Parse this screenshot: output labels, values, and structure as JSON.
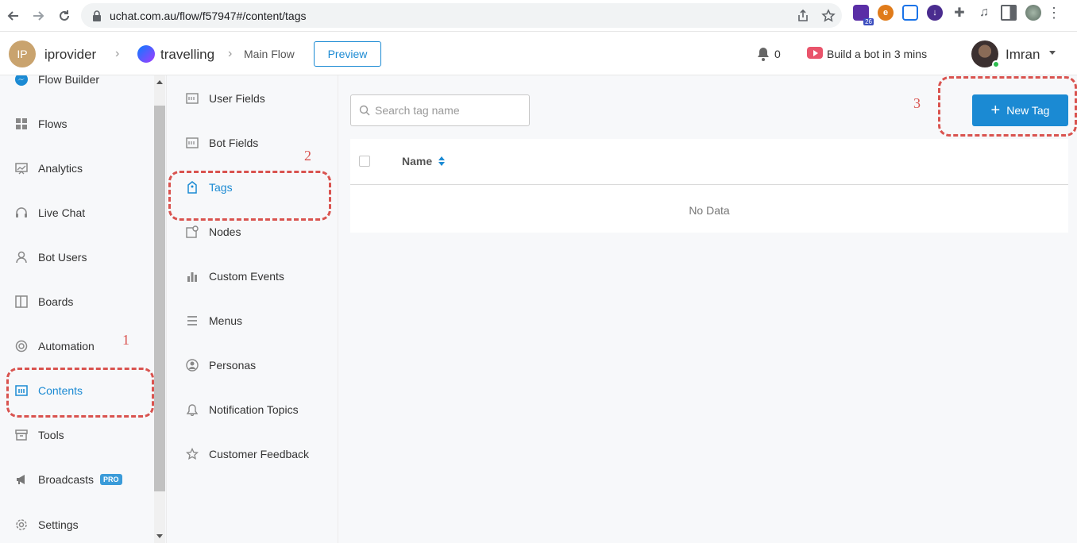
{
  "browser": {
    "url": "uchat.com.au/flow/f57947#/content/tags",
    "ext_badge": "26"
  },
  "header": {
    "workspace_initials": "IP",
    "workspace_name": "iprovider",
    "bot_name": "travelling",
    "flow_name": "Main Flow",
    "preview_label": "Preview",
    "notification_count": "0",
    "build_link": "Build a bot in 3 mins",
    "user_name": "Imran"
  },
  "sidebar": {
    "items": [
      {
        "label": "Flow Builder",
        "icon": "messenger-icon"
      },
      {
        "label": "Flows",
        "icon": "grid-icon"
      },
      {
        "label": "Analytics",
        "icon": "chart-icon"
      },
      {
        "label": "Live Chat",
        "icon": "headset-icon"
      },
      {
        "label": "Bot Users",
        "icon": "user-icon"
      },
      {
        "label": "Boards",
        "icon": "board-icon"
      },
      {
        "label": "Automation",
        "icon": "lifebuoy-icon"
      },
      {
        "label": "Contents",
        "icon": "content-icon",
        "active": true
      },
      {
        "label": "Tools",
        "icon": "box-icon"
      },
      {
        "label": "Broadcasts",
        "icon": "megaphone-icon",
        "badge": "PRO"
      },
      {
        "label": "Settings",
        "icon": "gear-icon"
      }
    ]
  },
  "submenu": {
    "items": [
      {
        "label": "User Fields",
        "icon": "field-icon"
      },
      {
        "label": "Bot Fields",
        "icon": "field-icon"
      },
      {
        "label": "Tags",
        "icon": "tag-icon",
        "active": true
      },
      {
        "label": "Nodes",
        "icon": "node-icon"
      },
      {
        "label": "Custom Events",
        "icon": "bar-chart-icon"
      },
      {
        "label": "Menus",
        "icon": "menu-icon"
      },
      {
        "label": "Personas",
        "icon": "persona-icon"
      },
      {
        "label": "Notification Topics",
        "icon": "bell-icon"
      },
      {
        "label": "Customer Feedback",
        "icon": "star-icon"
      }
    ]
  },
  "main": {
    "search_placeholder": "Search tag name",
    "new_tag_label": "New Tag",
    "table": {
      "columns": [
        "Name"
      ],
      "empty_text": "No Data"
    }
  },
  "annotations": [
    "1",
    "2",
    "3"
  ],
  "colors": {
    "accent": "#1b8ad3",
    "annotation": "#d9534f",
    "pro_badge": "#3a9bd9"
  }
}
